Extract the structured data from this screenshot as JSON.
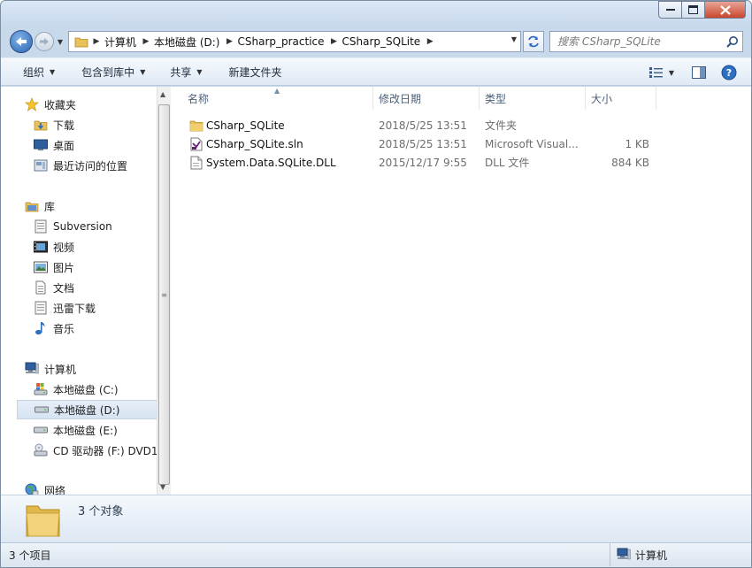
{
  "window": {
    "controls": {
      "minimize": "–",
      "maximize": "□",
      "close": "✕"
    }
  },
  "address_bar": {
    "crumbs": [
      "计算机",
      "本地磁盘 (D:)",
      "CSharp_practice",
      "CSharp_SQLite"
    ],
    "icon": "folder-icon"
  },
  "search": {
    "placeholder": "搜索 CSharp_SQLite"
  },
  "toolbar": {
    "organize": "组织",
    "include_in_library": "包含到库中",
    "share": "共享",
    "new_folder": "新建文件夹"
  },
  "nav": {
    "favorites": {
      "title": "收藏夹",
      "items": [
        "下载",
        "桌面",
        "最近访问的位置"
      ]
    },
    "libraries": {
      "title": "库",
      "items": [
        "Subversion",
        "视频",
        "图片",
        "文档",
        "迅雷下载",
        "音乐"
      ]
    },
    "computer": {
      "title": "计算机",
      "items": [
        "本地磁盘 (C:)",
        "本地磁盘 (D:)",
        "本地磁盘 (E:)",
        "CD 驱动器 (F:) DVD1"
      ],
      "selected_index": 1
    },
    "network": {
      "title": "网络"
    }
  },
  "columns": {
    "name": "名称",
    "date": "修改日期",
    "type": "类型",
    "size": "大小"
  },
  "files": [
    {
      "name": "CSharp_SQLite",
      "date": "2018/5/25 13:51",
      "type": "文件夹",
      "size": "",
      "icon": "folder-icon"
    },
    {
      "name": "CSharp_SQLite.sln",
      "date": "2018/5/25 13:51",
      "type": "Microsoft Visual...",
      "size": "1 KB",
      "icon": "visual-studio-solution-icon"
    },
    {
      "name": "System.Data.SQLite.DLL",
      "date": "2015/12/17 9:55",
      "type": "DLL 文件",
      "size": "884 KB",
      "icon": "dll-file-icon"
    }
  ],
  "details": {
    "count": "3 个对象"
  },
  "status": {
    "left": "3 个项目",
    "right": "计算机"
  }
}
